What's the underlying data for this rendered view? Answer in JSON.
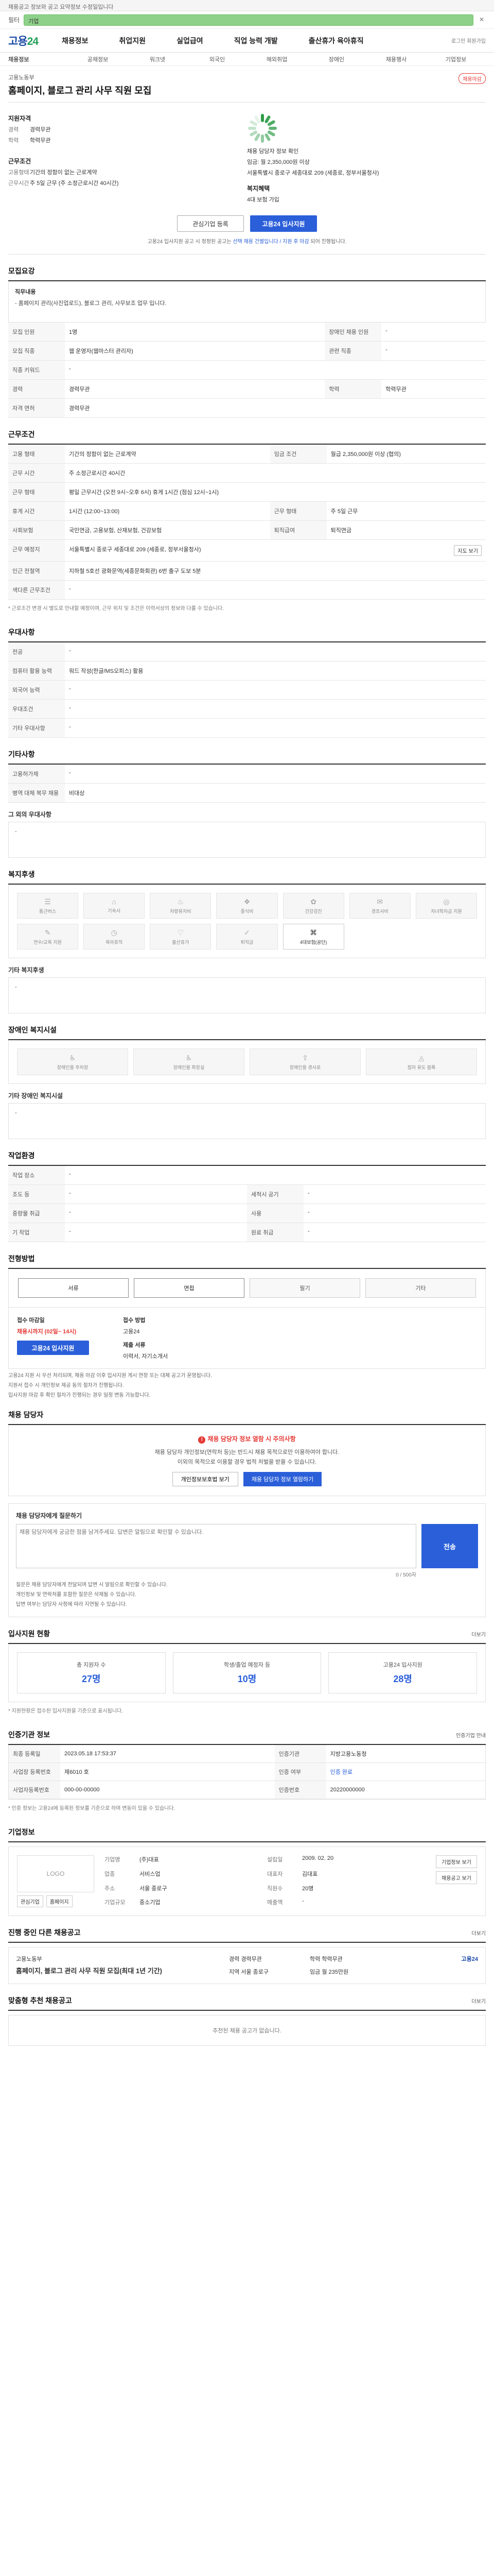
{
  "topbar": {
    "text": "채용공고 정보와 공고 요약정보 수정일입니다"
  },
  "filter": {
    "label": "필터",
    "value": "기업"
  },
  "gnb": {
    "logo_a": "고용",
    "logo_b": "24",
    "menu": [
      "채용정보",
      "취업지원",
      "실업급여",
      "직업 능력 개발",
      "출산휴가 육아휴직"
    ],
    "right": "로그인 회원가입"
  },
  "submenu": [
    "채용정보",
    "공채정보",
    "워크넷",
    "외국인",
    "해외취업",
    "장애인",
    "채용행사",
    "기업정보"
  ],
  "job": {
    "company": "고용노동부",
    "title": "홈페이지, 블로그 관리 사무 직원 모집",
    "deadline_badge": "채용마감",
    "summary": {
      "qualification_title": "지원자격",
      "rows": [
        {
          "k": "경력",
          "v": "경력무관"
        },
        {
          "k": "학력",
          "v": "학력무관"
        }
      ],
      "cond_title": "근무조건",
      "cond_rows": [
        {
          "k": "고용형태",
          "v": "기간의 정함이 없는 근로계약"
        },
        {
          "k": "근무시간",
          "v": "주 5일 근무 (주 소정근로시간 40시간)"
        }
      ],
      "mid_items": [
        "채용 담당자 정보 확인",
        "임금: 월 2,350,000원 이상",
        "서울특별시 종로구 세종대로 209 (세종로, 정부서울청사)",
        "근무 예정지"
      ],
      "welfare_title": "복지혜택",
      "welfare_text": "4대 보험 가입"
    },
    "cta": {
      "save": "관심기업 등록",
      "apply": "고용24 입사지원"
    },
    "note_a": "고용24 입사지원 공고 시 정정된 공고는 ",
    "note_b": "선택 채용 건별입니다 / 지원 후 마감",
    "note_c": " 되어 진행됩니다."
  },
  "recruit": {
    "title": "모집요강",
    "duty_title": "직무내용",
    "duty_text": "- 홈페이지 관리(사진업로드), 블로그 관리, 사무보조 업무 입니다.",
    "rows": [
      {
        "k": "모집 인원",
        "v": "1명",
        "k2": "장애인 채용 인원",
        "v2": "-"
      },
      {
        "k": "모집 직종",
        "v": "웹 운영자(웹마스터 관리자)",
        "k2": "관련 직종",
        "v2": "-"
      },
      {
        "k": "직종 키워드",
        "v": "-",
        "k2": "",
        "v2": ""
      },
      {
        "k": "경력",
        "v": "경력무관",
        "k2": "학력",
        "v2": "학력무관"
      },
      {
        "k": "자격 면허",
        "v": "경력무관",
        "k2": "",
        "v2": ""
      }
    ]
  },
  "work": {
    "title": "근무조건",
    "rows": [
      {
        "k": "고용 형태",
        "v": "기간의 정함이 없는 근로계약",
        "k2": "임금 조건",
        "v2": "월급 2,350,000원 이상 (협의)"
      },
      {
        "k": "근무 시간",
        "v": "주 소정근로시간 40시간",
        "k2": "",
        "v2": ""
      },
      {
        "k": "근무 형태",
        "v": "평일 근무시간 (오전 9시~오후 6시) 휴게 1시간 (점심 12시~1시)",
        "k2": "",
        "v2": ""
      },
      {
        "k": "휴게 시간",
        "v": "1시간 (12:00~13:00)",
        "k2": "근무 형태",
        "v2": "주 5일 근무"
      },
      {
        "k": "사회보험",
        "v": "국민연금, 고용보험, 산재보험, 건강보험",
        "k2": "퇴직급여",
        "v2": "퇴직연금"
      },
      {
        "k": "근무 예정지",
        "v": "서울특별시 종로구 세종대로 209 (세종로, 정부서울청사)",
        "k2": "",
        "v2": ""
      },
      {
        "k": "인근 전철역",
        "v": "지하철 5호선 광화문역(세종문화회관) 6번 출구 도보 5분",
        "k2": "",
        "v2": ""
      },
      {
        "k": "색다른 근무조건",
        "v": "-",
        "k2": "",
        "v2": ""
      }
    ],
    "map_btn": "지도 보기",
    "footnote": "* 근로조건 변경 시 별도로 안내할 예정이며, 근무 위치 및 조건은 이력서상의 정보와 다를 수 있습니다."
  },
  "pref": {
    "title": "우대사항",
    "rows": [
      {
        "k": "전공",
        "v": "-"
      },
      {
        "k": "컴퓨터 활용 능력",
        "v": "워드 작성(한글/MS오피스) 활용"
      },
      {
        "k": "외국어 능력",
        "v": "-"
      },
      {
        "k": "우대조건",
        "v": "-"
      },
      {
        "k": "기타 우대사항",
        "v": "-"
      }
    ]
  },
  "etc": {
    "title": "기타사항",
    "rows": [
      {
        "k": "고용허가제",
        "v": "-"
      },
      {
        "k": "병역 대체 복무 채용",
        "v": "비대상"
      }
    ],
    "sub_title": "그 외의 우대사항",
    "sub_text": "-"
  },
  "welfare": {
    "title": "복지후생",
    "items": [
      {
        "icon": "☰",
        "label": "통근버스",
        "on": false
      },
      {
        "icon": "⌂",
        "label": "기숙사",
        "on": false
      },
      {
        "icon": "♨",
        "label": "차량유지비",
        "on": false
      },
      {
        "icon": "❖",
        "label": "중식비",
        "on": false
      },
      {
        "icon": "✿",
        "label": "건강검진",
        "on": false
      },
      {
        "icon": "✉",
        "label": "경조사비",
        "on": false
      },
      {
        "icon": "◎",
        "label": "자녀학자금 지원",
        "on": false
      },
      {
        "icon": "✎",
        "label": "연수/교육 지원",
        "on": false
      },
      {
        "icon": "◷",
        "label": "육아휴직",
        "on": false
      },
      {
        "icon": "♡",
        "label": "출산휴가",
        "on": false
      },
      {
        "icon": "✓",
        "label": "퇴직금",
        "on": false
      },
      {
        "icon": "⌘",
        "label": "4대보험(공단)",
        "on": true
      }
    ],
    "sub_title": "기타 복지후생",
    "sub_text": "-"
  },
  "disabled": {
    "title": "장애인 복지시설",
    "items": [
      {
        "icon": "♿",
        "label": "장애인용 주차장"
      },
      {
        "icon": "♿",
        "label": "장애인용 화장실"
      },
      {
        "icon": "⇪",
        "label": "장애인용 경사로"
      },
      {
        "icon": "◬",
        "label": "점자 유도 블록"
      }
    ],
    "sub_title": "기타 장애인 복지시설",
    "sub_text": "-"
  },
  "workenv": {
    "title": "작업환경",
    "rows": [
      {
        "k": "작업 장소",
        "v": "-",
        "k2": "",
        "v2": ""
      },
      {
        "k": "조도 등",
        "v": "-",
        "k2": "세척시 공기",
        "v2": "-"
      },
      {
        "k": "중량물 취급",
        "v": "-",
        "k2": "사용",
        "v2": "-"
      },
      {
        "k": "기 작업",
        "v": "-",
        "k2": "원료 취급",
        "v2": "-"
      }
    ]
  },
  "process": {
    "title": "전형방법",
    "steps": [
      "서류",
      "면접",
      "필기",
      "기타"
    ],
    "apply_label": "접수 마감일",
    "apply_date": "채용시까지 (02일~ 14시)",
    "apply_btn": "고용24 입사지원",
    "method_label": "접수 방법",
    "method_value": "고용24",
    "docs_label": "제출 서류",
    "docs_value": "이력서, 자기소개서",
    "bullets": [
      "고용24 지원 시 우선 처리되며, 채용 마감 이후 입사지원 게시 연장 또는 대체 공고가 운영됩니다.",
      "지원서 접수 시 개인정보 제공 동의 절차가 진행됩니다.",
      "입사지원 마감 후 확인 절차가 진행되는 경우 일정 변동 가능합니다."
    ]
  },
  "manager": {
    "title": "채용 담당자",
    "warn": "채용 담당자 정보 열람 시 주의사항",
    "lines": [
      "채용 담당자 개인정보(연락처 등)는 반드시 채용 목적으로만 이용하여야 합니다.",
      "이외의 목적으로 이용할 경우 법적 처벌을 받을 수 있습니다."
    ],
    "btn1": "개인정보보호법 보기",
    "btn2": "채용 담당자 정보 열람하기"
  },
  "qa": {
    "title": "채용 담당자에게 질문하기",
    "placeholder": "채용 담당자에게 궁금한 점을 남겨주세요. 답변은 알림으로 확인할 수 있습니다.",
    "submit": "전송",
    "count": "0 / 500자",
    "notes": [
      "질문은 채용 담당자에게 전달되며 답변 시 알림으로 확인할 수 있습니다.",
      "개인정보 및 연락처를 포함한 질문은 삭제될 수 있습니다.",
      "답변 여부는 담당자 사정에 따라 지연될 수 있습니다."
    ]
  },
  "applicants": {
    "title": "입사지원 현황",
    "more": "더보기",
    "stats": [
      {
        "label": "총 지원자 수",
        "value": "27명"
      },
      {
        "label": "학생/졸업 예정자 등",
        "value": "10명"
      },
      {
        "label": "고용24 입사지원",
        "value": "28명"
      }
    ],
    "note": "* 지원현황은 접수된 입사지원을 기준으로 표시됩니다."
  },
  "cert": {
    "title": "인증기관 정보",
    "btn": "인증기업 안내",
    "rows": [
      {
        "k": "최종 등록일",
        "v": "2023.05.18 17:53:37",
        "k2": "인증기관",
        "v2": "지방고용노동청",
        "ok": false
      },
      {
        "k": "사업장 등록번호",
        "v": "제6010 호",
        "k2": "인증 여부",
        "v2": "인증 완료",
        "ok": true
      },
      {
        "k": "사업자등록번호",
        "v": "000-00-00000",
        "k2": "인증번호",
        "v2": "20220000000",
        "ok": false
      }
    ],
    "note": "* 인증 정보는 고용24에 등록된 정보를 기준으로 하며 변동이 있을 수 있습니다."
  },
  "company": {
    "title": "기업정보",
    "logo_text": "LOGO",
    "actions": [
      "관심기업",
      "홈페이지"
    ],
    "info": [
      {
        "k": "기업명",
        "v": "(주)대표"
      },
      {
        "k": "설립일",
        "v": "2009. 02. 20"
      },
      {
        "k": "업종",
        "v": "서비스업"
      },
      {
        "k": "대표자",
        "v": "김대표"
      },
      {
        "k": "주소",
        "v": "서울 종로구"
      },
      {
        "k": "직원수",
        "v": "20명"
      },
      {
        "k": "기업규모",
        "v": "중소기업"
      },
      {
        "k": "매출액",
        "v": "-"
      }
    ],
    "btns": [
      "기업정보 보기",
      "채용공고 보기"
    ]
  },
  "recent": {
    "title": "진행 중인 다른 채용공고",
    "more": "더보기",
    "company": "고용노동부",
    "name": "홈페이지, 블로그 관리 사무 직원 모집(최대 1년 기간)",
    "meta": [
      {
        "k": "경력",
        "v": "경력무관"
      },
      {
        "k": "학력",
        "v": "학력무관"
      },
      {
        "k": "지역",
        "v": "서울 종로구"
      },
      {
        "k": "임금",
        "v": "월 235만원"
      }
    ],
    "brand": "고용24"
  },
  "recommend": {
    "title": "맞춤형 추천 채용공고",
    "more": "더보기",
    "empty": "추천된 채용 공고가 없습니다."
  }
}
